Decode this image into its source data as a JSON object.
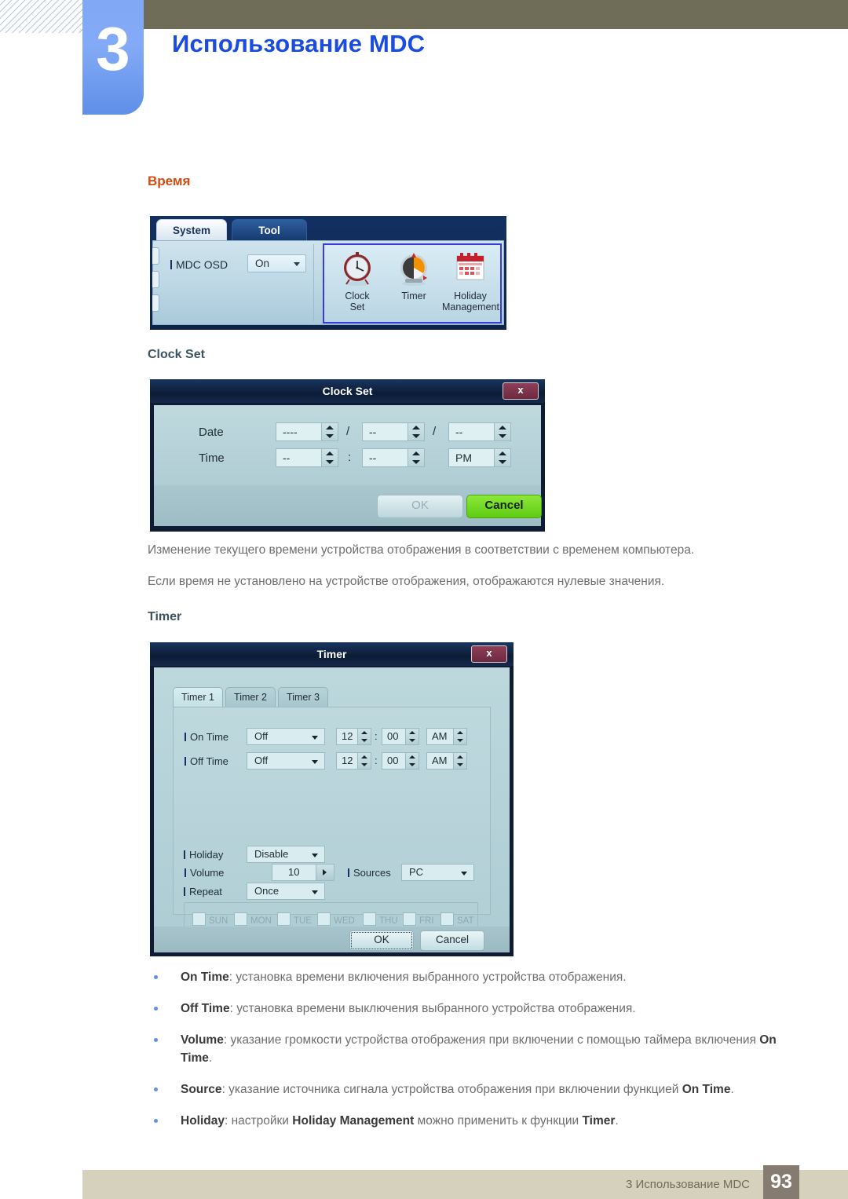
{
  "chapter": {
    "number": "3",
    "title": "Использование MDC"
  },
  "section_heading": "Время",
  "system_panel": {
    "tabs": [
      {
        "label": "System",
        "active": true
      },
      {
        "label": "Tool",
        "active": false
      }
    ],
    "osd": {
      "label": "MDC OSD",
      "value": "On",
      "caret": "chevron-down-icon"
    },
    "items": [
      {
        "icon": "clock-icon",
        "label_line1": "Clock",
        "label_line2": "Set"
      },
      {
        "icon": "timer-icon",
        "label_line1": "Timer",
        "label_line2": ""
      },
      {
        "icon": "calendar-icon",
        "label_line1": "Holiday",
        "label_line2": "Management"
      }
    ]
  },
  "clock_set_heading": "Clock Set",
  "clock_set_dialog": {
    "title": "Clock Set",
    "close_label": "x",
    "date_label": "Date",
    "time_label": "Time",
    "date": {
      "year": "----",
      "month": "--",
      "day": "--",
      "separator": "/"
    },
    "time": {
      "hour": "--",
      "minute": "--",
      "meridiem": "PM",
      "separator": ":"
    },
    "ok_label": "OK",
    "cancel_label": "Cancel"
  },
  "paragraphs": [
    "Изменение текущего времени устройства отображения в соответствии с временем компьютера.",
    "Если время не установлено на устройстве отображения, отображаются нулевые значения."
  ],
  "timer_heading": "Timer",
  "timer_dialog": {
    "title": "Timer",
    "close_label": "x",
    "tabs": [
      {
        "label": "Timer 1",
        "active": true
      },
      {
        "label": "Timer 2",
        "active": false
      },
      {
        "label": "Timer 3",
        "active": false
      }
    ],
    "on_time": {
      "label": "On Time",
      "mode": "Off",
      "hour": "12",
      "minute": "00",
      "meridiem": "AM",
      "separator": ":"
    },
    "off_time": {
      "label": "Off Time",
      "mode": "Off",
      "hour": "12",
      "minute": "00",
      "meridiem": "AM",
      "separator": ":"
    },
    "volume": {
      "label": "Volume",
      "value": "10"
    },
    "sources": {
      "label": "Sources",
      "value": "PC"
    },
    "holiday": {
      "label": "Holiday",
      "value": "Disable"
    },
    "repeat": {
      "label": "Repeat",
      "value": "Once"
    },
    "days": [
      "SUN",
      "MON",
      "TUE",
      "WED",
      "THU",
      "FRI",
      "SAT"
    ],
    "ok_label": "OK",
    "cancel_label": "Cancel"
  },
  "bullets": [
    {
      "term": "On Time",
      "text": ": установка времени включения выбранного устройства отображения."
    },
    {
      "term": "Off Time",
      "text": ": установка времени выключения выбранного устройства отображения."
    },
    {
      "term": "Volume",
      "text": ": указание громкости устройства отображения при включении с помощью таймера включения ",
      "term2": "On Time",
      "tail": "."
    },
    {
      "term": "Source",
      "text": ": указание источника сигнала устройства отображения при включении функцией ",
      "term2": "On Time",
      "tail": "."
    },
    {
      "term": "Holiday",
      "text": ": настройки ",
      "term2": "Holiday Management",
      "text2": " можно применить к функции ",
      "term3": "Timer",
      "tail": "."
    }
  ],
  "footer": {
    "text": "3 Использование MDC",
    "page": "93"
  },
  "colors": {
    "header_bar": "#6f6c57",
    "chapter_tab": "#7fa8f5",
    "chapter_title": "#1b4ce0",
    "section_heading": "#d9480f",
    "sub_heading": "#3c5360",
    "body_text": "#6d6e70",
    "footer_bar": "#d6d1bd",
    "footer_page_box": "#867b71",
    "dialog_accent": "#3b3bd8",
    "cancel_green": "#5fcc12"
  }
}
